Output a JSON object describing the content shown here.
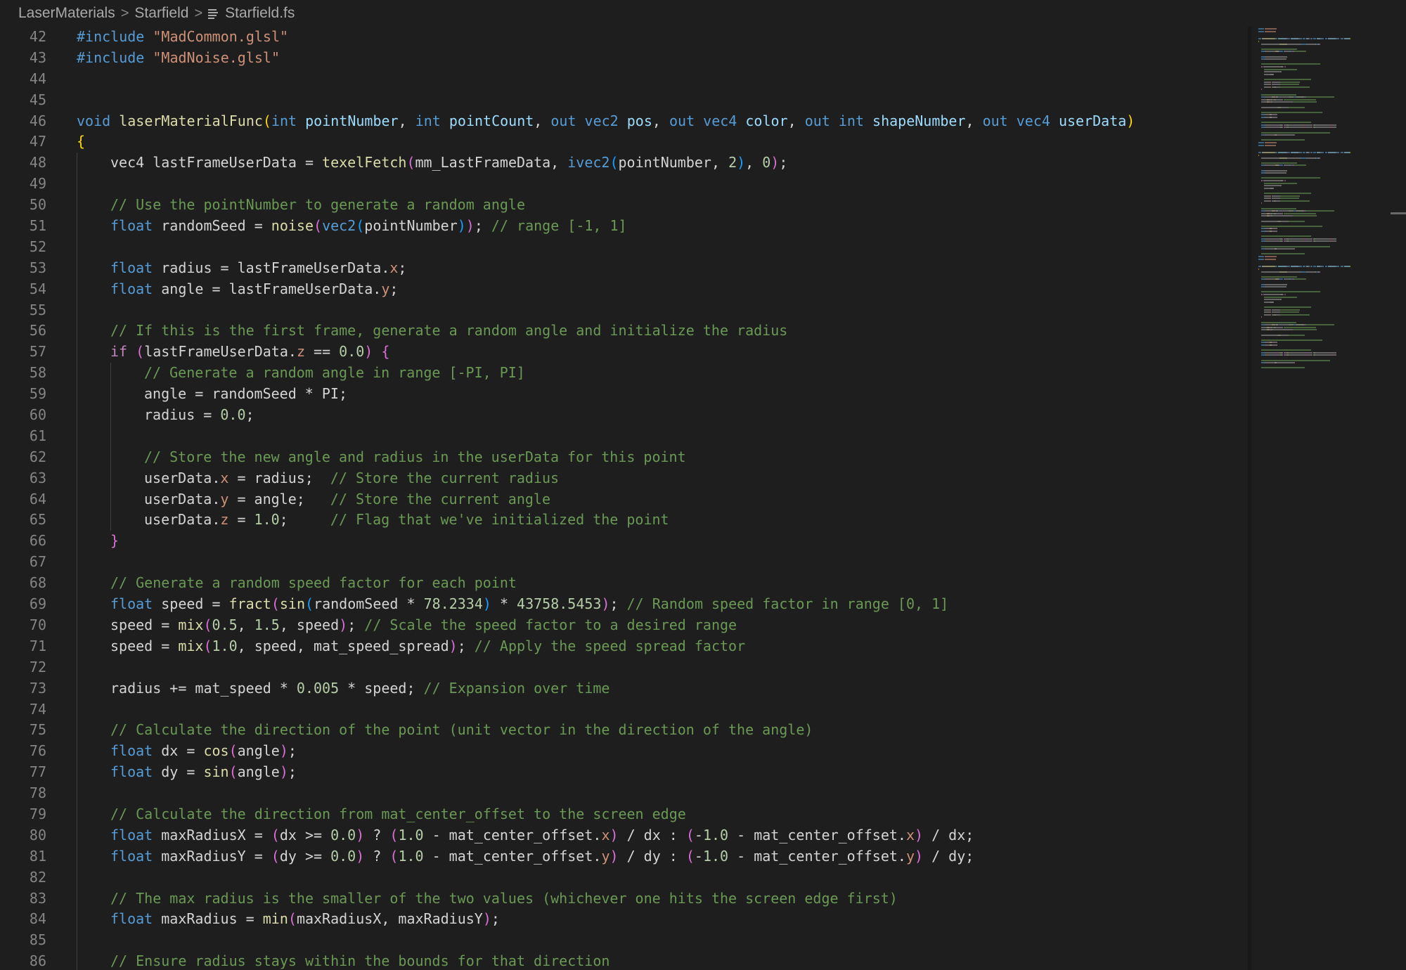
{
  "breadcrumb": {
    "items": [
      "LaserMaterials",
      "Starfield"
    ],
    "file": "Starfield.fs",
    "separator": ">"
  },
  "colors": {
    "background": "#1e1e1e",
    "keyword": "#569cd6",
    "control": "#c586c0",
    "function": "#dcdcaa",
    "string": "#ce9178",
    "comment": "#6a9955",
    "number": "#b5cea8",
    "line_number": "#858585"
  },
  "icons": {
    "file": "file-lines-icon",
    "separator": "chevron-right-icon"
  },
  "editor": {
    "lines": [
      {
        "n": "42",
        "indent": 0,
        "tokens": [
          [
            "kw",
            "#include"
          ],
          [
            "p",
            " "
          ],
          [
            "str",
            "\"MadCommon.glsl\""
          ]
        ]
      },
      {
        "n": "43",
        "indent": 0,
        "tokens": [
          [
            "kw",
            "#include"
          ],
          [
            "p",
            " "
          ],
          [
            "str",
            "\"MadNoise.glsl\""
          ]
        ]
      },
      {
        "n": "44",
        "indent": 0,
        "tokens": []
      },
      {
        "n": "45",
        "indent": 0,
        "tokens": []
      },
      {
        "n": "46",
        "indent": 0,
        "tokens": [
          [
            "kw",
            "void"
          ],
          [
            "p",
            " "
          ],
          [
            "fn",
            "laserMaterialFunc"
          ],
          [
            "b1",
            "("
          ],
          [
            "kw",
            "int"
          ],
          [
            "p",
            " "
          ],
          [
            "var",
            "pointNumber"
          ],
          [
            "p",
            ", "
          ],
          [
            "kw",
            "int"
          ],
          [
            "p",
            " "
          ],
          [
            "var",
            "pointCount"
          ],
          [
            "p",
            ", "
          ],
          [
            "kw",
            "out"
          ],
          [
            "p",
            " "
          ],
          [
            "kw",
            "vec2"
          ],
          [
            "p",
            " "
          ],
          [
            "var",
            "pos"
          ],
          [
            "p",
            ", "
          ],
          [
            "kw",
            "out"
          ],
          [
            "p",
            " "
          ],
          [
            "kw",
            "vec4"
          ],
          [
            "p",
            " "
          ],
          [
            "var",
            "color"
          ],
          [
            "p",
            ", "
          ],
          [
            "kw",
            "out"
          ],
          [
            "p",
            " "
          ],
          [
            "kw",
            "int"
          ],
          [
            "p",
            " "
          ],
          [
            "var",
            "shapeNumber"
          ],
          [
            "p",
            ", "
          ],
          [
            "kw",
            "out"
          ],
          [
            "p",
            " "
          ],
          [
            "kw",
            "vec4"
          ],
          [
            "p",
            " "
          ],
          [
            "var",
            "userData"
          ],
          [
            "b1",
            ")"
          ]
        ]
      },
      {
        "n": "47",
        "indent": 0,
        "tokens": [
          [
            "b1",
            "{"
          ]
        ]
      },
      {
        "n": "48",
        "indent": 1,
        "tokens": [
          [
            "p",
            "vec4 lastFrameUserData = "
          ],
          [
            "fn",
            "texelFetch"
          ],
          [
            "b2",
            "("
          ],
          [
            "p",
            "mm_LastFrameData, "
          ],
          [
            "kw",
            "ivec2"
          ],
          [
            "b3",
            "("
          ],
          [
            "p",
            "pointNumber, "
          ],
          [
            "num",
            "2"
          ],
          [
            "b3",
            ")"
          ],
          [
            "p",
            ", "
          ],
          [
            "num",
            "0"
          ],
          [
            "b2",
            ")"
          ],
          [
            "p",
            ";"
          ]
        ]
      },
      {
        "n": "49",
        "indent": 1,
        "tokens": []
      },
      {
        "n": "50",
        "indent": 1,
        "tokens": [
          [
            "cm",
            "// Use the pointNumber to generate a random angle"
          ]
        ]
      },
      {
        "n": "51",
        "indent": 1,
        "tokens": [
          [
            "kw",
            "float"
          ],
          [
            "p",
            " randomSeed = "
          ],
          [
            "fn",
            "noise"
          ],
          [
            "b2",
            "("
          ],
          [
            "kw",
            "vec2"
          ],
          [
            "b3",
            "("
          ],
          [
            "p",
            "pointNumber"
          ],
          [
            "b3",
            ")"
          ],
          [
            "b2",
            ")"
          ],
          [
            "p",
            "; "
          ],
          [
            "cm",
            "// range [-1, 1]"
          ]
        ]
      },
      {
        "n": "52",
        "indent": 1,
        "tokens": []
      },
      {
        "n": "53",
        "indent": 1,
        "tokens": [
          [
            "kw",
            "float"
          ],
          [
            "p",
            " radius = lastFrameUserData."
          ],
          [
            "sw",
            "x"
          ],
          [
            "p",
            ";"
          ]
        ]
      },
      {
        "n": "54",
        "indent": 1,
        "tokens": [
          [
            "kw",
            "float"
          ],
          [
            "p",
            " angle = lastFrameUserData."
          ],
          [
            "sw",
            "y"
          ],
          [
            "p",
            ";"
          ]
        ]
      },
      {
        "n": "55",
        "indent": 1,
        "tokens": []
      },
      {
        "n": "56",
        "indent": 1,
        "tokens": [
          [
            "cm",
            "// If this is the first frame, generate a random angle and initialize the radius"
          ]
        ]
      },
      {
        "n": "57",
        "indent": 1,
        "tokens": [
          [
            "ctrl",
            "if"
          ],
          [
            "p",
            " "
          ],
          [
            "b2",
            "("
          ],
          [
            "p",
            "lastFrameUserData."
          ],
          [
            "sw",
            "z"
          ],
          [
            "p",
            " == "
          ],
          [
            "num",
            "0.0"
          ],
          [
            "b2",
            ")"
          ],
          [
            "p",
            " "
          ],
          [
            "b2",
            "{"
          ]
        ]
      },
      {
        "n": "58",
        "indent": 2,
        "tokens": [
          [
            "cm",
            "// Generate a random angle in range [-PI, PI]"
          ]
        ]
      },
      {
        "n": "59",
        "indent": 2,
        "tokens": [
          [
            "p",
            "angle = randomSeed * PI;"
          ]
        ]
      },
      {
        "n": "60",
        "indent": 2,
        "tokens": [
          [
            "p",
            "radius = "
          ],
          [
            "num",
            "0.0"
          ],
          [
            "p",
            ";"
          ]
        ]
      },
      {
        "n": "61",
        "indent": 2,
        "tokens": []
      },
      {
        "n": "62",
        "indent": 2,
        "tokens": [
          [
            "cm",
            "// Store the new angle and radius in the userData for this point"
          ]
        ]
      },
      {
        "n": "63",
        "indent": 2,
        "tokens": [
          [
            "p",
            "userData."
          ],
          [
            "sw",
            "x"
          ],
          [
            "p",
            " = radius;  "
          ],
          [
            "cm",
            "// Store the current radius"
          ]
        ]
      },
      {
        "n": "64",
        "indent": 2,
        "tokens": [
          [
            "p",
            "userData."
          ],
          [
            "sw",
            "y"
          ],
          [
            "p",
            " = angle;   "
          ],
          [
            "cm",
            "// Store the current angle"
          ]
        ]
      },
      {
        "n": "65",
        "indent": 2,
        "tokens": [
          [
            "p",
            "userData."
          ],
          [
            "sw",
            "z"
          ],
          [
            "p",
            " = "
          ],
          [
            "num",
            "1.0"
          ],
          [
            "p",
            ";     "
          ],
          [
            "cm",
            "// Flag that we've initialized the point"
          ]
        ]
      },
      {
        "n": "66",
        "indent": 1,
        "tokens": [
          [
            "b2",
            "}"
          ]
        ]
      },
      {
        "n": "67",
        "indent": 1,
        "tokens": []
      },
      {
        "n": "68",
        "indent": 1,
        "tokens": [
          [
            "cm",
            "// Generate a random speed factor for each point"
          ]
        ]
      },
      {
        "n": "69",
        "indent": 1,
        "tokens": [
          [
            "kw",
            "float"
          ],
          [
            "p",
            " speed = "
          ],
          [
            "fn",
            "fract"
          ],
          [
            "b2",
            "("
          ],
          [
            "fn",
            "sin"
          ],
          [
            "b3",
            "("
          ],
          [
            "p",
            "randomSeed * "
          ],
          [
            "num",
            "78.2334"
          ],
          [
            "b3",
            ")"
          ],
          [
            "p",
            " * "
          ],
          [
            "num",
            "43758.5453"
          ],
          [
            "b2",
            ")"
          ],
          [
            "p",
            "; "
          ],
          [
            "cm",
            "// Random speed factor in range [0, 1]"
          ]
        ]
      },
      {
        "n": "70",
        "indent": 1,
        "tokens": [
          [
            "p",
            "speed = "
          ],
          [
            "fn",
            "mix"
          ],
          [
            "b2",
            "("
          ],
          [
            "num",
            "0.5"
          ],
          [
            "p",
            ", "
          ],
          [
            "num",
            "1.5"
          ],
          [
            "p",
            ", speed"
          ],
          [
            "b2",
            ")"
          ],
          [
            "p",
            "; "
          ],
          [
            "cm",
            "// Scale the speed factor to a desired range"
          ]
        ]
      },
      {
        "n": "71",
        "indent": 1,
        "tokens": [
          [
            "p",
            "speed = "
          ],
          [
            "fn",
            "mix"
          ],
          [
            "b2",
            "("
          ],
          [
            "num",
            "1.0"
          ],
          [
            "p",
            ", speed, mat_speed_spread"
          ],
          [
            "b2",
            ")"
          ],
          [
            "p",
            "; "
          ],
          [
            "cm",
            "// Apply the speed spread factor"
          ]
        ]
      },
      {
        "n": "72",
        "indent": 1,
        "tokens": []
      },
      {
        "n": "73",
        "indent": 1,
        "tokens": [
          [
            "p",
            "radius += mat_speed * "
          ],
          [
            "num",
            "0.005"
          ],
          [
            "p",
            " * speed; "
          ],
          [
            "cm",
            "// Expansion over time"
          ]
        ]
      },
      {
        "n": "74",
        "indent": 1,
        "tokens": []
      },
      {
        "n": "75",
        "indent": 1,
        "tokens": [
          [
            "cm",
            "// Calculate the direction of the point (unit vector in the direction of the angle)"
          ]
        ]
      },
      {
        "n": "76",
        "indent": 1,
        "tokens": [
          [
            "kw",
            "float"
          ],
          [
            "p",
            " dx = "
          ],
          [
            "fn",
            "cos"
          ],
          [
            "b2",
            "("
          ],
          [
            "p",
            "angle"
          ],
          [
            "b2",
            ")"
          ],
          [
            "p",
            ";"
          ]
        ]
      },
      {
        "n": "77",
        "indent": 1,
        "tokens": [
          [
            "kw",
            "float"
          ],
          [
            "p",
            " dy = "
          ],
          [
            "fn",
            "sin"
          ],
          [
            "b2",
            "("
          ],
          [
            "p",
            "angle"
          ],
          [
            "b2",
            ")"
          ],
          [
            "p",
            ";"
          ]
        ]
      },
      {
        "n": "78",
        "indent": 1,
        "tokens": []
      },
      {
        "n": "79",
        "indent": 1,
        "tokens": [
          [
            "cm",
            "// Calculate the direction from mat_center_offset to the screen edge"
          ]
        ]
      },
      {
        "n": "80",
        "indent": 1,
        "tokens": [
          [
            "kw",
            "float"
          ],
          [
            "p",
            " maxRadiusX = "
          ],
          [
            "b2",
            "("
          ],
          [
            "p",
            "dx >= "
          ],
          [
            "num",
            "0.0"
          ],
          [
            "b2",
            ")"
          ],
          [
            "p",
            " ? "
          ],
          [
            "b2",
            "("
          ],
          [
            "num",
            "1.0"
          ],
          [
            "p",
            " - mat_center_offset."
          ],
          [
            "sw",
            "x"
          ],
          [
            "b2",
            ")"
          ],
          [
            "p",
            " / dx : "
          ],
          [
            "b2",
            "("
          ],
          [
            "p",
            "-"
          ],
          [
            "num",
            "1.0"
          ],
          [
            "p",
            " - mat_center_offset."
          ],
          [
            "sw",
            "x"
          ],
          [
            "b2",
            ")"
          ],
          [
            "p",
            " / dx;"
          ]
        ]
      },
      {
        "n": "81",
        "indent": 1,
        "tokens": [
          [
            "kw",
            "float"
          ],
          [
            "p",
            " maxRadiusY = "
          ],
          [
            "b2",
            "("
          ],
          [
            "p",
            "dy >= "
          ],
          [
            "num",
            "0.0"
          ],
          [
            "b2",
            ")"
          ],
          [
            "p",
            " ? "
          ],
          [
            "b2",
            "("
          ],
          [
            "num",
            "1.0"
          ],
          [
            "p",
            " - mat_center_offset."
          ],
          [
            "sw",
            "y"
          ],
          [
            "b2",
            ")"
          ],
          [
            "p",
            " / dy : "
          ],
          [
            "b2",
            "("
          ],
          [
            "p",
            "-"
          ],
          [
            "num",
            "1.0"
          ],
          [
            "p",
            " - mat_center_offset."
          ],
          [
            "sw",
            "y"
          ],
          [
            "b2",
            ")"
          ],
          [
            "p",
            " / dy;"
          ]
        ]
      },
      {
        "n": "82",
        "indent": 1,
        "tokens": []
      },
      {
        "n": "83",
        "indent": 1,
        "tokens": [
          [
            "cm",
            "// The max radius is the smaller of the two values (whichever one hits the screen edge first)"
          ]
        ]
      },
      {
        "n": "84",
        "indent": 1,
        "tokens": [
          [
            "kw",
            "float"
          ],
          [
            "p",
            " maxRadius = "
          ],
          [
            "fn",
            "min"
          ],
          [
            "b2",
            "("
          ],
          [
            "p",
            "maxRadiusX, maxRadiusY"
          ],
          [
            "b2",
            ")"
          ],
          [
            "p",
            ";"
          ]
        ]
      },
      {
        "n": "85",
        "indent": 1,
        "tokens": []
      },
      {
        "n": "86",
        "indent": 1,
        "tokens": [
          [
            "cm",
            "// Ensure radius stays within the bounds for that direction"
          ]
        ]
      }
    ]
  }
}
